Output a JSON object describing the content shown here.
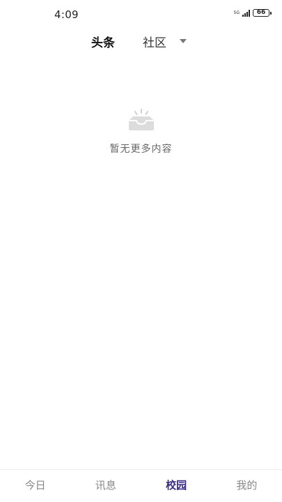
{
  "status_bar": {
    "time": "4:09",
    "network": "5G",
    "battery": "66"
  },
  "top_tabs": {
    "headlines": "头条",
    "community": "社区",
    "dropdown_icon": "caret-down-icon"
  },
  "empty_state": {
    "icon": "empty-inbox-icon",
    "message": "暂无更多内容"
  },
  "bottom_nav": {
    "items": [
      {
        "label": "今日"
      },
      {
        "label": "讯息"
      },
      {
        "label": "校园",
        "active": true
      },
      {
        "label": "我的"
      }
    ],
    "active_color": "#3b2a8a",
    "inactive_color": "#888888"
  }
}
